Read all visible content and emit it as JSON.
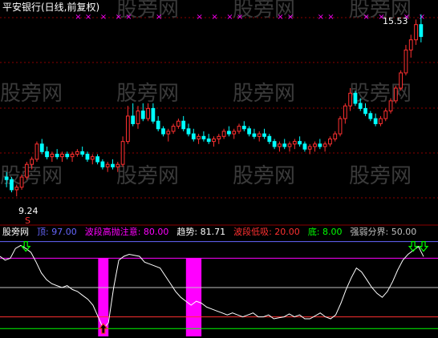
{
  "chart_data": [
    {
      "type": "candlestick",
      "title": "平安银行(日线,前复权)",
      "annotations": {
        "high_label": "15.53",
        "low_label": "9.24",
        "low_marker": "S"
      },
      "watermark": "股旁网",
      "ylim": [
        8.3,
        16.4
      ],
      "colors": {
        "up": "#ff3030",
        "down": "#00ffff",
        "grid": "#8b0000",
        "marker_x": "#ff00ff",
        "title": "#ffffff"
      },
      "ohlc": [
        [
          10.0,
          10.2,
          9.6,
          9.9
        ],
        [
          9.9,
          10.0,
          9.4,
          9.5
        ],
        [
          9.5,
          9.7,
          9.24,
          9.6
        ],
        [
          9.6,
          10.1,
          9.5,
          10.0
        ],
        [
          10.0,
          10.6,
          9.9,
          10.5
        ],
        [
          10.5,
          10.8,
          10.3,
          10.7
        ],
        [
          10.7,
          11.4,
          10.6,
          11.3
        ],
        [
          11.3,
          11.5,
          10.9,
          11.0
        ],
        [
          11.0,
          11.2,
          10.7,
          10.8
        ],
        [
          10.8,
          11.0,
          10.6,
          10.9
        ],
        [
          10.9,
          11.1,
          10.7,
          10.8
        ],
        [
          10.8,
          11.0,
          10.6,
          10.9
        ],
        [
          10.9,
          11.0,
          10.7,
          10.8
        ],
        [
          10.8,
          11.0,
          10.6,
          10.9
        ],
        [
          10.9,
          11.1,
          10.8,
          11.0
        ],
        [
          11.0,
          11.2,
          10.8,
          10.9
        ],
        [
          10.9,
          11.0,
          10.6,
          10.7
        ],
        [
          10.7,
          10.9,
          10.5,
          10.8
        ],
        [
          10.8,
          10.9,
          10.5,
          10.6
        ],
        [
          10.6,
          10.7,
          10.3,
          10.4
        ],
        [
          10.4,
          10.6,
          10.2,
          10.5
        ],
        [
          10.5,
          10.7,
          10.3,
          10.4
        ],
        [
          10.4,
          10.6,
          10.2,
          10.5
        ],
        [
          10.5,
          11.6,
          10.4,
          11.4
        ],
        [
          11.4,
          12.8,
          11.3,
          12.4
        ],
        [
          12.4,
          12.9,
          12.0,
          12.1
        ],
        [
          12.1,
          12.8,
          11.9,
          12.6
        ],
        [
          12.6,
          12.9,
          12.2,
          12.3
        ],
        [
          12.3,
          12.9,
          12.2,
          12.7
        ],
        [
          12.7,
          12.9,
          12.1,
          12.2
        ],
        [
          12.2,
          12.4,
          11.8,
          11.9
        ],
        [
          11.9,
          12.0,
          11.6,
          11.7
        ],
        [
          11.7,
          11.9,
          11.4,
          11.8
        ],
        [
          11.8,
          12.1,
          11.7,
          12.0
        ],
        [
          12.0,
          12.3,
          11.9,
          12.2
        ],
        [
          12.2,
          12.4,
          11.8,
          11.9
        ],
        [
          11.9,
          12.1,
          11.6,
          11.7
        ],
        [
          11.7,
          11.9,
          11.4,
          11.5
        ],
        [
          11.5,
          11.7,
          11.3,
          11.6
        ],
        [
          11.6,
          11.8,
          11.4,
          11.5
        ],
        [
          11.5,
          11.7,
          11.3,
          11.4
        ],
        [
          11.4,
          11.6,
          11.2,
          11.5
        ],
        [
          11.5,
          11.7,
          11.3,
          11.6
        ],
        [
          11.6,
          11.9,
          11.5,
          11.8
        ],
        [
          11.8,
          12.0,
          11.6,
          11.7
        ],
        [
          11.7,
          11.9,
          11.5,
          11.8
        ],
        [
          11.8,
          12.1,
          11.7,
          12.0
        ],
        [
          12.0,
          12.2,
          11.8,
          11.9
        ],
        [
          11.9,
          12.0,
          11.6,
          11.7
        ],
        [
          11.7,
          11.9,
          11.5,
          11.6
        ],
        [
          11.6,
          11.8,
          11.4,
          11.7
        ],
        [
          11.7,
          11.9,
          11.5,
          11.6
        ],
        [
          11.6,
          11.7,
          11.3,
          11.4
        ],
        [
          11.4,
          11.5,
          11.1,
          11.2
        ],
        [
          11.2,
          11.4,
          11.0,
          11.3
        ],
        [
          11.3,
          11.5,
          11.1,
          11.2
        ],
        [
          11.2,
          11.4,
          11.0,
          11.3
        ],
        [
          11.3,
          11.5,
          11.1,
          11.4
        ],
        [
          11.4,
          11.6,
          11.2,
          11.3
        ],
        [
          11.3,
          11.4,
          11.0,
          11.1
        ],
        [
          11.1,
          11.3,
          10.9,
          11.2
        ],
        [
          11.2,
          11.4,
          11.0,
          11.3
        ],
        [
          11.3,
          11.5,
          11.1,
          11.2
        ],
        [
          11.2,
          11.4,
          11.0,
          11.3
        ],
        [
          11.3,
          11.6,
          11.2,
          11.5
        ],
        [
          11.5,
          11.8,
          11.4,
          11.7
        ],
        [
          11.7,
          12.4,
          11.6,
          12.3
        ],
        [
          12.3,
          12.9,
          12.1,
          12.8
        ],
        [
          12.8,
          13.5,
          12.6,
          13.3
        ],
        [
          13.3,
          13.4,
          12.8,
          12.9
        ],
        [
          12.9,
          13.1,
          12.6,
          12.7
        ],
        [
          12.7,
          12.9,
          12.4,
          12.5
        ],
        [
          12.5,
          12.6,
          12.2,
          12.3
        ],
        [
          12.3,
          12.5,
          12.0,
          12.1
        ],
        [
          12.1,
          12.4,
          12.0,
          12.3
        ],
        [
          12.3,
          12.7,
          12.2,
          12.6
        ],
        [
          12.6,
          13.1,
          12.5,
          13.0
        ],
        [
          13.0,
          13.6,
          12.9,
          13.5
        ],
        [
          13.5,
          14.2,
          13.4,
          14.1
        ],
        [
          14.1,
          15.2,
          14.0,
          15.0
        ],
        [
          15.0,
          15.6,
          14.7,
          15.4
        ],
        [
          15.4,
          16.2,
          15.2,
          16.0
        ],
        [
          16.0,
          16.4,
          15.3,
          15.53
        ]
      ],
      "markers_x": [
        14,
        16,
        19,
        22,
        24,
        30,
        38,
        41,
        44,
        46,
        54,
        56,
        62,
        64,
        71,
        74,
        79,
        82
      ]
    },
    {
      "type": "line",
      "legend": [
        {
          "label": "股旁网",
          "color": "#ffffff"
        },
        {
          "label": "顶: 97.00",
          "color": "#6666ff"
        },
        {
          "label": "波段高抛注意: 80.00",
          "color": "#ff00ff"
        },
        {
          "label": "趋势: 81.71",
          "color": "#ffffff"
        },
        {
          "label": "波段低吸: 20.00",
          "color": "#ff3030"
        },
        {
          "label": "底: 8.00",
          "color": "#00ff00"
        },
        {
          "label": "强弱分界: 50.00",
          "color": "#c0c0c0"
        }
      ],
      "ylim": [
        0,
        100
      ],
      "hlines": [
        {
          "value": 97,
          "color": "#6666ff"
        },
        {
          "value": 80,
          "color": "#ff00ff"
        },
        {
          "value": 50,
          "color": "#c0c0c0"
        },
        {
          "value": 20,
          "color": "#ff3030"
        },
        {
          "value": 8,
          "color": "#00ff00"
        }
      ],
      "series": [
        {
          "color": "#ffffff",
          "values": [
            82,
            78,
            80,
            90,
            93,
            90,
            86,
            76,
            65,
            58,
            54,
            52,
            50,
            52,
            48,
            46,
            42,
            38,
            32,
            20,
            8,
            14,
            50,
            78,
            82,
            84,
            83,
            82,
            76,
            74,
            72,
            70,
            62,
            54,
            46,
            40,
            36,
            32,
            36,
            34,
            30,
            28,
            26,
            24,
            22,
            24,
            22,
            20,
            22,
            24,
            20,
            20,
            22,
            18,
            19,
            20,
            23,
            20,
            22,
            18,
            18,
            21,
            24,
            20,
            18,
            22,
            34,
            48,
            60,
            70,
            66,
            58,
            50,
            44,
            40,
            46,
            56,
            68,
            78,
            84,
            88,
            92,
            81.71
          ]
        }
      ],
      "fill_bars": [
        {
          "from": 19,
          "to": 20,
          "color": "#ff00ff"
        },
        {
          "from": 36,
          "to": 38,
          "color": "#ff00ff"
        }
      ],
      "arrows": [
        {
          "x": 5,
          "dir": "down",
          "color": "#00ff00"
        },
        {
          "x": 20,
          "dir": "up",
          "color": "#ff3030"
        },
        {
          "x": 80,
          "dir": "down",
          "color": "#00ff00"
        },
        {
          "x": 82,
          "dir": "down",
          "color": "#00ff00"
        }
      ]
    }
  ]
}
